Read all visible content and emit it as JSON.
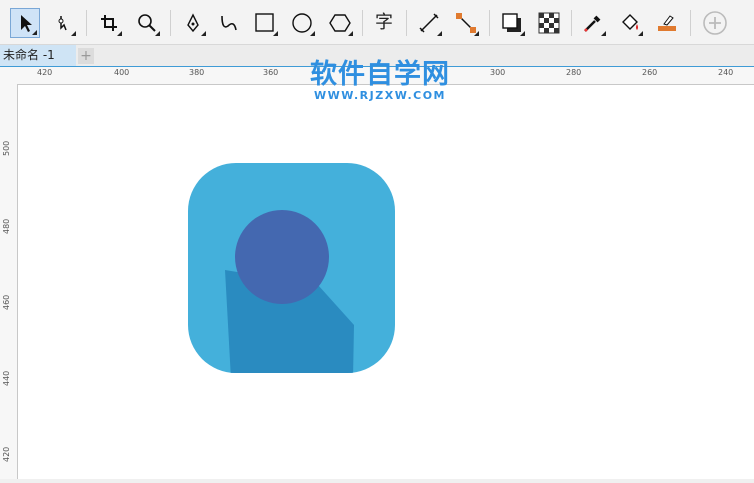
{
  "toolbar": {
    "tools": [
      {
        "name": "pick-tool",
        "icon": "arrow-pointer-icon",
        "active": true
      },
      {
        "name": "shape-tool",
        "icon": "node-edit-icon"
      },
      {
        "name": "crop-tool",
        "icon": "crop-icon"
      },
      {
        "name": "zoom-tool",
        "icon": "magnifier-icon"
      },
      {
        "name": "pen-tool",
        "icon": "pen-nib-icon"
      },
      {
        "name": "artistic-media-tool",
        "icon": "curve-icon"
      },
      {
        "name": "rectangle-tool",
        "icon": "rectangle-icon"
      },
      {
        "name": "ellipse-tool",
        "icon": "ellipse-icon"
      },
      {
        "name": "polygon-tool",
        "icon": "polygon-icon"
      },
      {
        "name": "text-tool",
        "icon": "text-icon",
        "glyph": "字"
      },
      {
        "name": "parallel-dimension-tool",
        "icon": "dimension-line-icon"
      },
      {
        "name": "connector-tool",
        "icon": "connector-icon"
      },
      {
        "name": "drop-shadow-tool",
        "icon": "drop-shadow-icon"
      },
      {
        "name": "transparency-tool",
        "icon": "checkerboard-icon"
      },
      {
        "name": "eyedropper-tool",
        "icon": "eyedropper-icon"
      },
      {
        "name": "interactive-fill-tool",
        "icon": "paint-bucket-icon"
      },
      {
        "name": "smart-fill-tool",
        "icon": "smart-fill-icon"
      },
      {
        "name": "add-tool",
        "icon": "plus-circle-icon"
      }
    ]
  },
  "document": {
    "tab_label": "未命名 -1",
    "add_tab": "+"
  },
  "rulers": {
    "horizontal": [
      "420",
      "400",
      "380",
      "360",
      "300",
      "280",
      "260",
      "240"
    ],
    "vertical": [
      "500",
      "480",
      "460",
      "440",
      "420"
    ]
  },
  "watermark": {
    "title": "软件自学网",
    "url": "WWW.RJZXW.COM"
  },
  "artwork": {
    "background_color": "#44b0db",
    "circle_color": "#4468b0",
    "body_color": "#2a8bc0"
  }
}
